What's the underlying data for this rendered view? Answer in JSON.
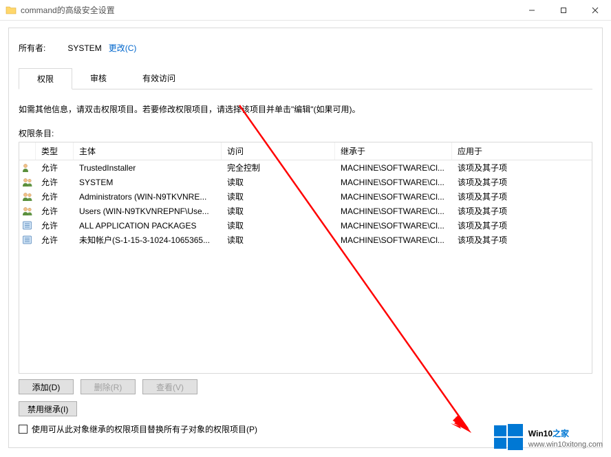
{
  "window": {
    "title": "command的高级安全设置",
    "controls": {
      "min": "–",
      "max": "▢",
      "close": "✕"
    }
  },
  "owner": {
    "label": "所有者:",
    "value": "SYSTEM",
    "change_link": "更改(C)"
  },
  "tabs": {
    "perm": "权限",
    "audit": "审核",
    "effective": "有效访问"
  },
  "hint": "如需其他信息，请双击权限项目。若要修改权限项目，请选择该项目并单击\"编辑\"(如果可用)。",
  "subheader": "权限条目:",
  "headers": {
    "type": "类型",
    "principal": "主体",
    "access": "访问",
    "inherit": "继承于",
    "apply": "应用于"
  },
  "rows": [
    {
      "icon": "user",
      "type": "允许",
      "principal": "TrustedInstaller",
      "access": "完全控制",
      "inherit": "MACHINE\\SOFTWARE\\Cl...",
      "apply": "该项及其子项"
    },
    {
      "icon": "group",
      "type": "允许",
      "principal": "SYSTEM",
      "access": "读取",
      "inherit": "MACHINE\\SOFTWARE\\Cl...",
      "apply": "该项及其子项"
    },
    {
      "icon": "group",
      "type": "允许",
      "principal": "Administrators (WIN-N9TKVNRE...",
      "access": "读取",
      "inherit": "MACHINE\\SOFTWARE\\Cl...",
      "apply": "该项及其子项"
    },
    {
      "icon": "group",
      "type": "允许",
      "principal": "Users (WIN-N9TKVNREPNF\\Use...",
      "access": "读取",
      "inherit": "MACHINE\\SOFTWARE\\Cl...",
      "apply": "该项及其子项"
    },
    {
      "icon": "pkg",
      "type": "允许",
      "principal": "ALL APPLICATION PACKAGES",
      "access": "读取",
      "inherit": "MACHINE\\SOFTWARE\\Cl...",
      "apply": "该项及其子项"
    },
    {
      "icon": "pkg",
      "type": "允许",
      "principal": "未知帐户(S-1-15-3-1024-1065365...",
      "access": "读取",
      "inherit": "MACHINE\\SOFTWARE\\Cl...",
      "apply": "该项及其子项"
    }
  ],
  "buttons": {
    "add": "添加(D)",
    "remove": "删除(R)",
    "view": "查看(V)",
    "disable_inherit": "禁用继承(I)"
  },
  "checkbox_label": "使用可从此对象继承的权限项目替换所有子对象的权限项目(P)",
  "watermark": {
    "line1a": "Win10",
    "line1b": "之家",
    "line2": "www.win10xitong.com"
  }
}
